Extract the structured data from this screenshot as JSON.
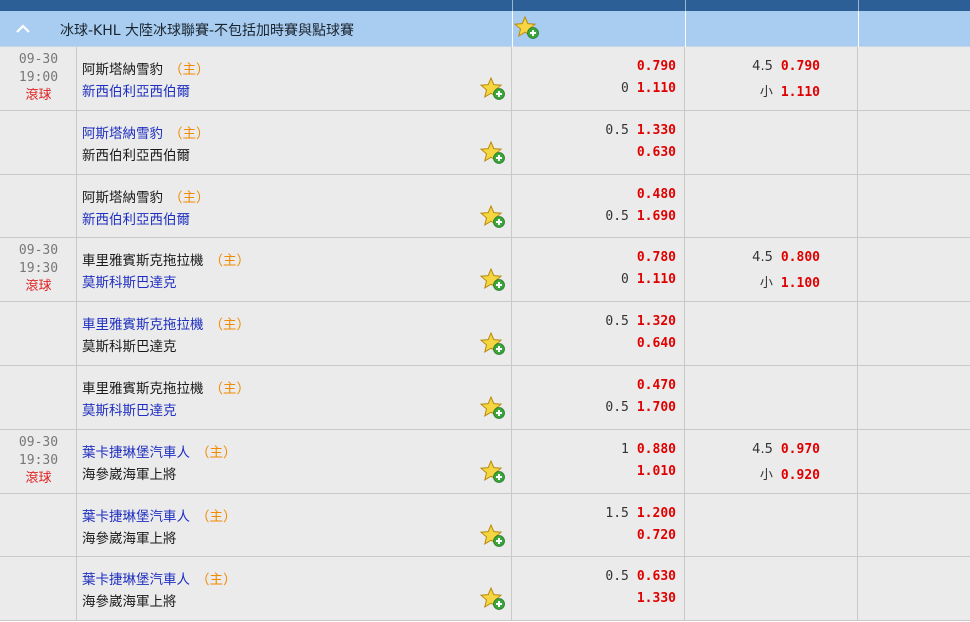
{
  "league": {
    "title": "冰球-KHL 大陸冰球聯賽-不包括加時賽與點球賽",
    "collapse_icon": "chevron-up-icon",
    "favorite_icon": "star-plus-icon"
  },
  "colors": {
    "header_bar": "#2c5f96",
    "league_bg": "#a8cdf0",
    "odds": "#e00000",
    "home_tag": "#f08a00",
    "favored_team": "#1f2fc0",
    "live": "#e02020"
  },
  "rows": [
    {
      "date": "09-30",
      "time": "19:00",
      "status": "滾球",
      "team1": "阿斯塔納雪豹",
      "team1_tag": "（主）",
      "team2": "新西伯利亞西伯爾",
      "fav": 2,
      "hdp1": "",
      "odds1": "0.790",
      "hdp2": "0",
      "odds2": "1.110",
      "ou1_line": "4.5",
      "ou1_odds": "0.790",
      "ou2_line": "小",
      "ou2_odds": "1.110"
    },
    {
      "date": "",
      "time": "",
      "status": "",
      "team1": "阿斯塔納雪豹",
      "team1_tag": "（主）",
      "team2": "新西伯利亞西伯爾",
      "fav": 1,
      "hdp1": "0.5",
      "odds1": "1.330",
      "hdp2": "",
      "odds2": "0.630",
      "ou1_line": "",
      "ou1_odds": "",
      "ou2_line": "",
      "ou2_odds": ""
    },
    {
      "date": "",
      "time": "",
      "status": "",
      "team1": "阿斯塔納雪豹",
      "team1_tag": "（主）",
      "team2": "新西伯利亞西伯爾",
      "fav": 2,
      "hdp1": "",
      "odds1": "0.480",
      "hdp2": "0.5",
      "odds2": "1.690",
      "ou1_line": "",
      "ou1_odds": "",
      "ou2_line": "",
      "ou2_odds": ""
    },
    {
      "date": "09-30",
      "time": "19:30",
      "status": "滾球",
      "team1": "車里雅賓斯克拖拉機",
      "team1_tag": "（主）",
      "team2": "莫斯科斯巴達克",
      "fav": 2,
      "hdp1": "",
      "odds1": "0.780",
      "hdp2": "0",
      "odds2": "1.110",
      "ou1_line": "4.5",
      "ou1_odds": "0.800",
      "ou2_line": "小",
      "ou2_odds": "1.100"
    },
    {
      "date": "",
      "time": "",
      "status": "",
      "team1": "車里雅賓斯克拖拉機",
      "team1_tag": "（主）",
      "team2": "莫斯科斯巴達克",
      "fav": 1,
      "hdp1": "0.5",
      "odds1": "1.320",
      "hdp2": "",
      "odds2": "0.640",
      "ou1_line": "",
      "ou1_odds": "",
      "ou2_line": "",
      "ou2_odds": ""
    },
    {
      "date": "",
      "time": "",
      "status": "",
      "team1": "車里雅賓斯克拖拉機",
      "team1_tag": "（主）",
      "team2": "莫斯科斯巴達克",
      "fav": 2,
      "hdp1": "",
      "odds1": "0.470",
      "hdp2": "0.5",
      "odds2": "1.700",
      "ou1_line": "",
      "ou1_odds": "",
      "ou2_line": "",
      "ou2_odds": ""
    },
    {
      "date": "09-30",
      "time": "19:30",
      "status": "滾球",
      "team1": "葉卡捷琳堡汽車人",
      "team1_tag": "（主）",
      "team2": "海參崴海軍上將",
      "fav": 1,
      "hdp1": "1",
      "odds1": "0.880",
      "hdp2": "",
      "odds2": "1.010",
      "ou1_line": "4.5",
      "ou1_odds": "0.970",
      "ou2_line": "小",
      "ou2_odds": "0.920"
    },
    {
      "date": "",
      "time": "",
      "status": "",
      "team1": "葉卡捷琳堡汽車人",
      "team1_tag": "（主）",
      "team2": "海參崴海軍上將",
      "fav": 1,
      "hdp1": "1.5",
      "odds1": "1.200",
      "hdp2": "",
      "odds2": "0.720",
      "ou1_line": "",
      "ou1_odds": "",
      "ou2_line": "",
      "ou2_odds": ""
    },
    {
      "date": "",
      "time": "",
      "status": "",
      "team1": "葉卡捷琳堡汽車人",
      "team1_tag": "（主）",
      "team2": "海參崴海軍上將",
      "fav": 1,
      "hdp1": "0.5",
      "odds1": "0.630",
      "hdp2": "",
      "odds2": "1.330",
      "ou1_line": "",
      "ou1_odds": "",
      "ou2_line": "",
      "ou2_odds": ""
    }
  ]
}
